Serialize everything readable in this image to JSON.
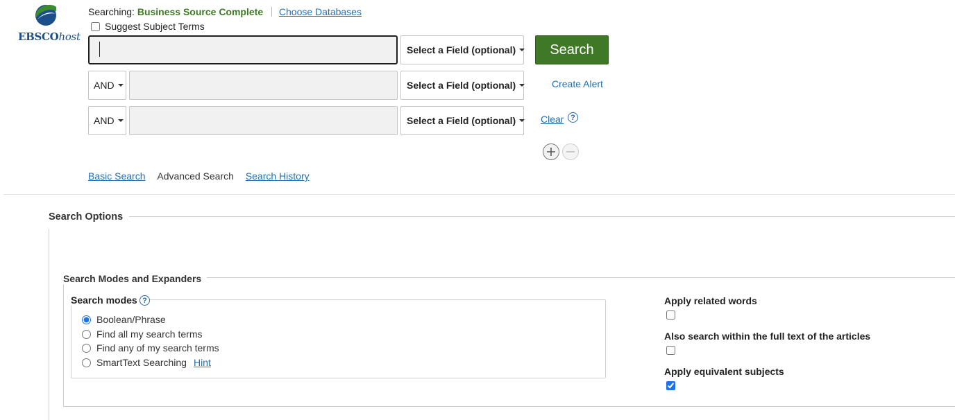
{
  "header": {
    "logo_text_bold": "EBSCO",
    "logo_text_italic": "host",
    "searching_label": "Searching:",
    "database_name": "Business Source Complete",
    "choose_databases": "Choose Databases",
    "suggest_subject_terms": "Suggest Subject Terms"
  },
  "search_rows": [
    {
      "boolean": "",
      "value": "",
      "field": "Select a Field (optional)"
    },
    {
      "boolean": "AND",
      "value": "",
      "field": "Select a Field (optional)"
    },
    {
      "boolean": "AND",
      "value": "",
      "field": "Select a Field (optional)"
    }
  ],
  "actions": {
    "search": "Search",
    "create_alert": "Create Alert",
    "clear": "Clear",
    "help": "?",
    "add_row": "+",
    "remove_row": "−"
  },
  "nav": {
    "basic_search": "Basic Search",
    "advanced_search": "Advanced Search",
    "search_history": "Search History"
  },
  "search_options": {
    "title": "Search Options",
    "modes_expanders_title": "Search Modes and Expanders",
    "search_modes_title": "Search modes",
    "modes": [
      {
        "label": "Boolean/Phrase",
        "selected": true
      },
      {
        "label": "Find all my search terms",
        "selected": false
      },
      {
        "label": "Find any of my search terms",
        "selected": false
      },
      {
        "label": "SmartText Searching",
        "selected": false
      }
    ],
    "hint": "Hint",
    "expanders": [
      {
        "label": "Apply related words",
        "checked": false
      },
      {
        "label": "Also search within the full text of the articles",
        "checked": false
      },
      {
        "label": "Apply equivalent subjects",
        "checked": true
      }
    ]
  },
  "colors": {
    "accent_green": "#3f7826",
    "link_blue": "#1f6fb5"
  }
}
